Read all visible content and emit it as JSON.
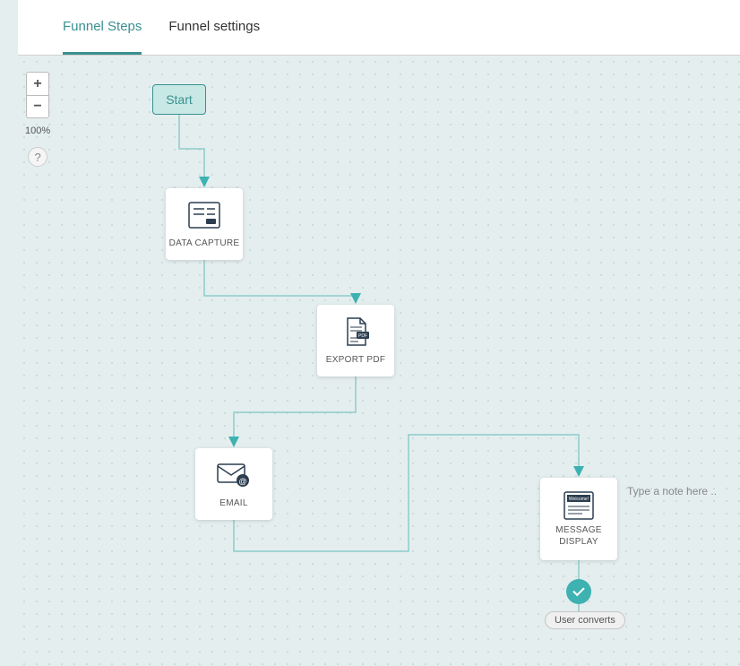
{
  "tabs": {
    "steps": "Funnel Steps",
    "settings": "Funnel settings"
  },
  "zoom": {
    "plus": "+",
    "minus": "−",
    "level": "100%",
    "help": "?"
  },
  "nodes": {
    "start": "Start",
    "data_capture": "DATA CAPTURE",
    "export_pdf": "EXPORT PDF",
    "email": "EMAIL",
    "message_display": "MESSAGE\nDISPLAY",
    "welcome_text": "Welcome!"
  },
  "note_placeholder": "Type a note here ..",
  "converts_label": "User converts",
  "colors": {
    "accent": "#3a9090",
    "node_border": "#2c3e50"
  }
}
